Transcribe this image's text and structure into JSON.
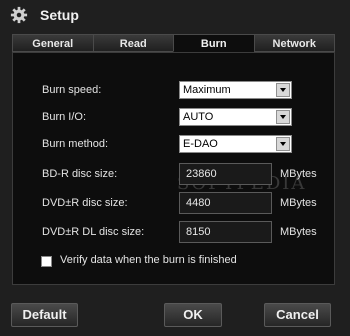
{
  "window": {
    "title": "Setup"
  },
  "tabs": [
    {
      "label": "General"
    },
    {
      "label": "Read"
    },
    {
      "label": "Burn"
    },
    {
      "label": "Network"
    }
  ],
  "burn": {
    "speed": {
      "label": "Burn speed:",
      "value": "Maximum"
    },
    "io": {
      "label": "Burn I/O:",
      "value": "AUTO"
    },
    "method": {
      "label": "Burn method:",
      "value": "E-DAO"
    },
    "bd_size": {
      "label": "BD-R disc size:",
      "value": "23860",
      "unit": "MBytes"
    },
    "dvd_size": {
      "label": "DVD±R disc size:",
      "value": "4480",
      "unit": "MBytes"
    },
    "dvd_dl_size": {
      "label": "DVD±R DL disc size:",
      "value": "8150",
      "unit": "MBytes"
    },
    "verify": {
      "label": "Verify data when the burn is finished",
      "checked": false
    }
  },
  "watermark": "SOFTPEDIA",
  "buttons": {
    "default": "Default",
    "ok": "OK",
    "cancel": "Cancel"
  }
}
